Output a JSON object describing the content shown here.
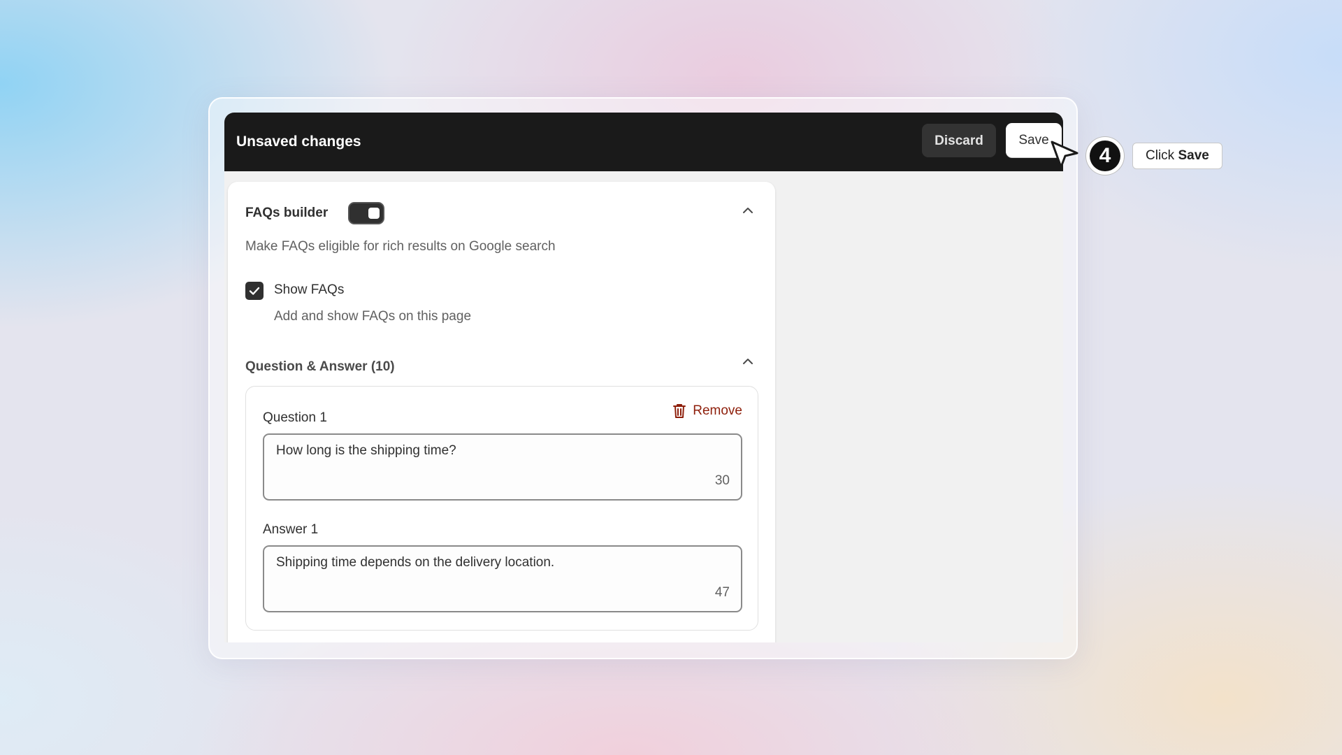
{
  "header": {
    "title": "Unsaved changes",
    "discard_label": "Discard",
    "save_label": "Save"
  },
  "faq_builder": {
    "title": "FAQs builder",
    "toggle_on": true,
    "description": "Make FAQs eligible for rich results on Google search",
    "show_faqs": {
      "checked": true,
      "label": "Show FAQs",
      "help": "Add and show FAQs on this page"
    }
  },
  "qa": {
    "section_title": "Question & Answer (10)",
    "items": [
      {
        "question_label": "Question 1",
        "remove_label": "Remove",
        "question_value": "How long is the shipping time?",
        "question_count": "30",
        "answer_label": "Answer 1",
        "answer_value": "Shipping time depends on the delivery location.",
        "answer_count": "47"
      }
    ]
  },
  "tutorial": {
    "step_number": "4",
    "tip_prefix": "Click",
    "tip_target": "Save"
  },
  "icons": {
    "collapse": "chevron-up-icon",
    "check": "check-icon",
    "trash": "trash-icon",
    "cursor": "cursor-arrow-icon"
  },
  "colors": {
    "topbar_bg": "#1a1a1a",
    "remove_color": "#8e1f0b",
    "control_dark": "#303030"
  }
}
